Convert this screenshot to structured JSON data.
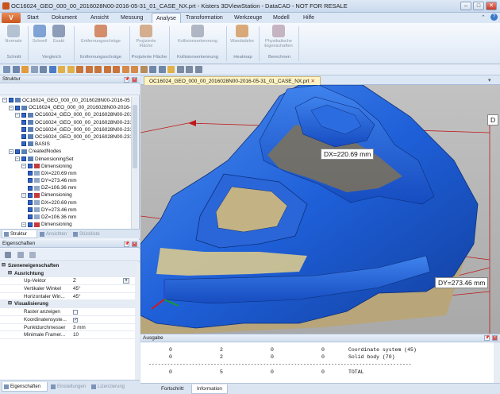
{
  "window": {
    "title": "OC16024_GEO_000_00_2016028N00-2016-05-31_01_CASE_NX.prt - Kisters 3DViewStation - DataCAD - NOT FOR RESALE"
  },
  "app_button": "V",
  "menu": [
    "Start",
    "Dokument",
    "Ansicht",
    "Messung",
    "Analyse",
    "Transformation",
    "Werkzeuge",
    "Modell",
    "Hilfe"
  ],
  "menu_active": "Analyse",
  "ribbon": {
    "buttons": [
      {
        "label": "Normale"
      },
      {
        "label": "Schnell"
      },
      {
        "label": "Exakt"
      },
      {
        "label": "Entfernungsschräge"
      },
      {
        "label": "Projizierte Fläche"
      },
      {
        "label": "Kollisionserkennung"
      },
      {
        "label": "Wandstärke"
      },
      {
        "label": "Physikalische Eigenschaften"
      }
    ],
    "groups": [
      "Schnitt",
      "Vergleich",
      "Entfernungsschräge",
      "Projizierte Fläche",
      "Kollisionserkennung",
      "Heatmap",
      "Berechnen"
    ]
  },
  "structure_panel": {
    "title": "Struktur",
    "tree": [
      {
        "label": "OC16024_GEO_000_00_2016028N00-2016-05",
        "indent": 0
      },
      {
        "label": "OC16024_GEO_000_00_2016028N00-2016-0",
        "indent": 1
      },
      {
        "label": "OC16024_GEO_000_00_2016028N00-2016-0",
        "indent": 2
      },
      {
        "label": "OC16024_GEO_000_00_2016028N00-2316",
        "indent": 3
      },
      {
        "label": "OC16024_GEO_000_00_2016028N00-2316",
        "indent": 3
      },
      {
        "label": "OC16024_GEO_000_00_2016028N00-2316",
        "indent": 3
      },
      {
        "label": "BASIS",
        "indent": 3
      },
      {
        "label": "CreatedNodes",
        "indent": 1
      },
      {
        "label": "DimensioningSet",
        "indent": 2
      },
      {
        "label": "Dimensioning",
        "indent": 3
      },
      {
        "label": "DX=220.69 mm",
        "indent": 4
      },
      {
        "label": "DY=273.46 mm",
        "indent": 4
      },
      {
        "label": "DZ=106.36 mm",
        "indent": 4
      },
      {
        "label": "Dimensioning",
        "indent": 3
      },
      {
        "label": "DX=220.69 mm",
        "indent": 4
      },
      {
        "label": "DY=273.46 mm",
        "indent": 4
      },
      {
        "label": "DZ=106.36 mm",
        "indent": 4
      },
      {
        "label": "Dimensioning",
        "indent": 3
      },
      {
        "label": "DX=220.69 mm",
        "indent": 4
      }
    ],
    "tabs": [
      "Struktur",
      "Ansichten",
      "Stückliste"
    ]
  },
  "properties_panel": {
    "title": "Eigenschaften",
    "rows": [
      {
        "type": "top",
        "key": "Szeneneigenschaften"
      },
      {
        "type": "cat",
        "key": "Ausrichtung"
      },
      {
        "type": "val",
        "key": "Up-Vektor",
        "value": "Z"
      },
      {
        "type": "val",
        "key": "Vertikaler Winkel",
        "value": "45°"
      },
      {
        "type": "val",
        "key": "Horizontaler Win...",
        "value": "45°"
      },
      {
        "type": "cat",
        "key": "Visualisierung"
      },
      {
        "type": "chk",
        "key": "Raster anzeigen",
        "checked": false
      },
      {
        "type": "chk",
        "key": "Koordinatensyste...",
        "checked": true
      },
      {
        "type": "val",
        "key": "Punktdurchmesser",
        "value": "3 mm"
      },
      {
        "type": "val",
        "key": "Minimale Framer...",
        "value": "10"
      }
    ],
    "tabs": [
      "Eigenschaften",
      "Einstellungen",
      "Lizenzierung"
    ]
  },
  "viewport": {
    "doc_tab": "OC16024_GEO_000_00_2016028N00-2016-05-31_01_CASE_NX.prt",
    "dimensions": {
      "dx": "DX=220.69 mm",
      "dy": "DY=273.46 mm",
      "dz_partial": "D"
    },
    "colors": {
      "part": "#1f5fd6",
      "background": "#b8b8b8",
      "dimension_line": "#c0181a"
    }
  },
  "output": {
    "title": "Ausgabe",
    "rows": [
      {
        "c1": "0",
        "c2": "2",
        "c3": "0",
        "c4": "0",
        "text": "Coordinate system (45)"
      },
      {
        "c1": "0",
        "c2": "2",
        "c3": "0",
        "c4": "0",
        "text": "Solid body (70)"
      },
      {
        "c1": "0",
        "c2": "5",
        "c3": "0",
        "c4": "0",
        "text": "TOTAL"
      }
    ],
    "separator": "-------------------------------------------------------------------------------------",
    "tabs": [
      "Fortschritt",
      "Information"
    ]
  }
}
